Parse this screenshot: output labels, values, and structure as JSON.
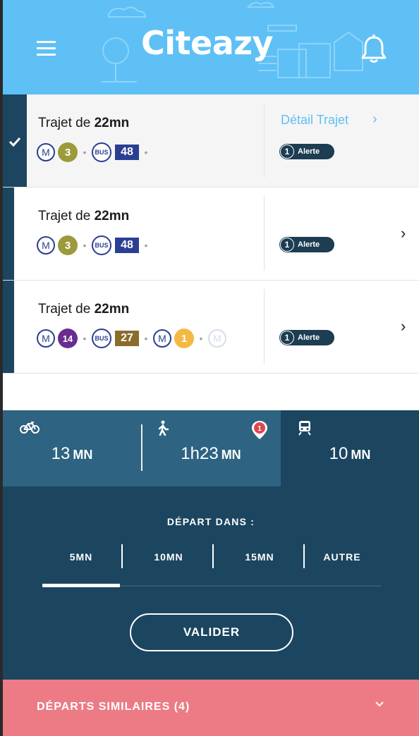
{
  "header": {
    "logo_text": "Citeazy",
    "bg_color": "#5ec0f5"
  },
  "routes": [
    {
      "title_prefix": "Trajet de",
      "duration": "22mn",
      "selected": true,
      "detail_label": "Détail Trajet",
      "alert_count": "1",
      "alert_label": "Alerte",
      "legs": [
        {
          "kind": "metro",
          "icon": "M",
          "line": "3",
          "color": "#9c9a3a"
        },
        {
          "kind": "bus",
          "icon": "BUS",
          "line": "48",
          "color": "#2b3f92"
        }
      ]
    },
    {
      "title_prefix": "Trajet de",
      "duration": "22mn",
      "selected": false,
      "alert_count": "1",
      "alert_label": "Alerte",
      "legs": [
        {
          "kind": "metro",
          "icon": "M",
          "line": "3",
          "color": "#9c9a3a"
        },
        {
          "kind": "bus",
          "icon": "BUS",
          "line": "48",
          "color": "#2b3f92"
        }
      ]
    },
    {
      "title_prefix": "Trajet de",
      "duration": "22mn",
      "selected": false,
      "alert_count": "1",
      "alert_label": "Alerte",
      "legs": [
        {
          "kind": "metro",
          "icon": "M",
          "line": "14",
          "color": "#6a2c91"
        },
        {
          "kind": "bus",
          "icon": "BUS",
          "line": "27",
          "color": "#8a6d2b"
        },
        {
          "kind": "metro",
          "icon": "M",
          "line": "1",
          "color": "#f4b942"
        },
        {
          "kind": "metro-faded",
          "icon": "M"
        }
      ]
    }
  ],
  "modes": {
    "bike": {
      "value": "13",
      "unit": "MN"
    },
    "walk": {
      "value": "1h23",
      "unit": "MN",
      "alert_count": "1"
    },
    "train": {
      "value": "10",
      "unit": "MN"
    }
  },
  "departure": {
    "title": "DÉPART DANS :",
    "options": [
      "5MN",
      "10MN",
      "15MN",
      "AUTRE"
    ],
    "selected": "5MN",
    "submit_label": "VALIDER"
  },
  "similar": {
    "label": "DÉPARTS SIMILAIRES (4)"
  },
  "colors": {
    "navy": "#1c4560",
    "tab_active": "#2e6381",
    "accent_sky": "#5ec0f5",
    "coral": "#ec7b86",
    "metro_blue": "#2b3f92"
  }
}
